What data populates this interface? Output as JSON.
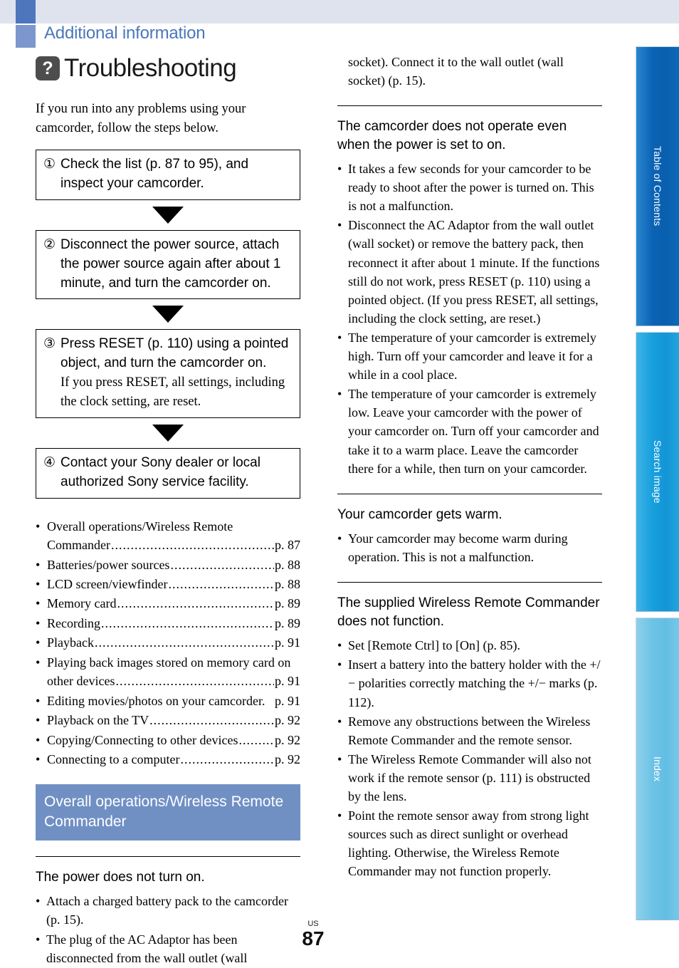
{
  "header": {
    "chapter": "Additional information",
    "title": "Troubleshooting",
    "title_icon": "question-mark-icon",
    "title_icon_glyph": "?"
  },
  "left_column": {
    "intro": "If you run into any problems using your camcorder, follow the steps below.",
    "steps": [
      {
        "number": "①",
        "text": "Check the list (p. 87 to 95), and inspect your camcorder.",
        "note": ""
      },
      {
        "number": "②",
        "text": "Disconnect the power source, attach the power source again after about 1 minute, and turn the camcorder on.",
        "note": ""
      },
      {
        "number": "③",
        "text": "Press RESET (p. 110) using a pointed object, and turn the camcorder on.",
        "note": "If you press RESET, all settings, including the clock setting, are reset."
      },
      {
        "number": "④",
        "text": "Contact your Sony dealer or local authorized Sony service facility.",
        "note": ""
      }
    ],
    "toc": [
      {
        "label": "Overall operations/Wireless Remote",
        "label2": "Commander",
        "page": "p. 87"
      },
      {
        "label": "Batteries/power sources ",
        "label2": "",
        "page": "p. 88"
      },
      {
        "label": "LCD screen/viewfinder",
        "label2": "",
        "page": "p. 88"
      },
      {
        "label": "Memory card ",
        "label2": "",
        "page": "p. 89"
      },
      {
        "label": "Recording",
        "label2": "",
        "page": "p. 89"
      },
      {
        "label": "Playback ",
        "label2": "",
        "page": "p. 91"
      },
      {
        "label": "Playing back images stored on memory card on",
        "label2": "other devices",
        "page": "p. 91"
      },
      {
        "label": "Editing movies/photos on your camcorder.",
        "label2": "",
        "page": "p. 91",
        "nodots": true
      },
      {
        "label": "Playback on the TV ",
        "label2": "",
        "page": "p. 92"
      },
      {
        "label": "Copying/Connecting to other devices ",
        "label2": "",
        "page": "p. 92"
      },
      {
        "label": "Connecting to a computer",
        "label2": "",
        "page": "p. 92"
      }
    ],
    "section_banner": "Overall operations/Wireless Remote Commander",
    "qa": [
      {
        "heading": "The power does not turn on.",
        "bullets": [
          "Attach a charged battery pack to the camcorder (p. 15).",
          "The plug of the AC Adaptor has been disconnected from the wall outlet (wall"
        ]
      }
    ]
  },
  "right_column": {
    "continuation": "socket). Connect it to the wall outlet (wall socket) (p. 15).",
    "qa": [
      {
        "heading": "The camcorder does not operate even when the power is set to on.",
        "bullets": [
          "It takes a few seconds for your camcorder to be ready to shoot after the power is turned on. This is not a malfunction.",
          "Disconnect the AC Adaptor from the wall outlet (wall socket) or remove the battery pack, then reconnect it after about 1 minute. If the functions still do not work, press RESET (p. 110) using a pointed object. (If you press RESET, all settings, including the clock setting, are reset.)",
          "The temperature of your camcorder is extremely high. Turn off your camcorder and leave it for a while in a cool place.",
          "The temperature of your camcorder is extremely low. Leave your camcorder with the power of your camcorder on. Turn off your camcorder and take it to a warm place. Leave the camcorder there for a while, then turn on your camcorder."
        ]
      },
      {
        "heading": "Your camcorder gets warm.",
        "bullets": [
          "Your camcorder may become warm during operation. This is not a malfunction."
        ]
      },
      {
        "heading": "The supplied Wireless Remote Commander does not function.",
        "bullets": [
          "Set [Remote Ctrl] to [On] (p. 85).",
          "Insert a battery into the battery holder with the +/− polarities correctly matching the +/− marks (p. 112).",
          "Remove any obstructions between the Wireless Remote Commander and the remote sensor.",
          "The Wireless Remote Commander will also not work if the remote sensor (p. 111) is obstructed by the lens.",
          "Point the remote sensor away from strong light sources such as direct sunlight or overhead lighting. Otherwise, the Wireless Remote Commander may not function properly."
        ]
      }
    ]
  },
  "side_tabs": [
    {
      "label": "Table of Contents",
      "color": "#0b63b5"
    },
    {
      "label": "Search image",
      "color": "#17a0de"
    },
    {
      "label": "Index",
      "color": "#6cc3e6"
    }
  ],
  "footer": {
    "region": "US",
    "page_number": "87"
  },
  "colors": {
    "chapter_blue": "#4a77bb",
    "banner_blue": "#7090c4",
    "top_band": "#dfe3ee",
    "icon_gray": "#4d4d4d"
  }
}
